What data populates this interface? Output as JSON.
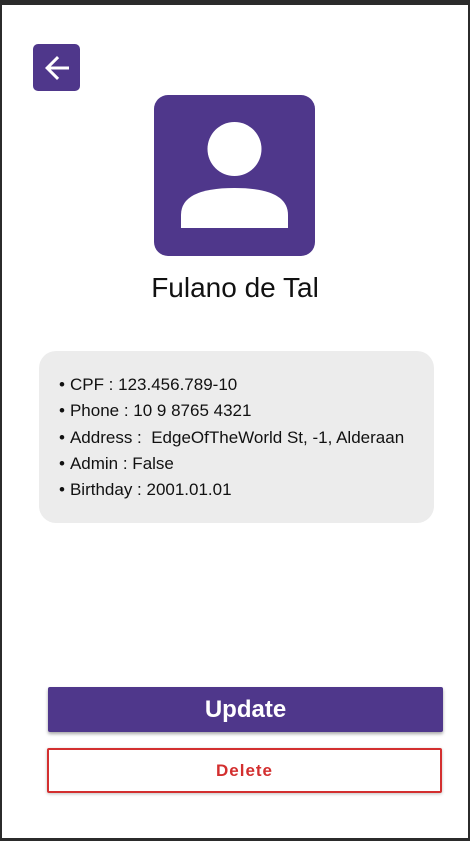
{
  "colors": {
    "primary": "#4f378b",
    "danger": "#d32f2f",
    "card_bg": "#ececec"
  },
  "header": {
    "back_icon": "arrow-left-icon"
  },
  "profile": {
    "avatar_icon": "person-icon",
    "name": "Fulano de Tal"
  },
  "details": [
    {
      "label": "CPF",
      "value": "123.456.789-10",
      "text": "CPF : 123.456.789-10"
    },
    {
      "label": "Phone",
      "value": "10 9 8765 4321",
      "text": "Phone : 10 9 8765 4321"
    },
    {
      "label": "Address",
      "value": "EdgeOfTheWorld St, -1, Alderaan",
      "text": "Address :  EdgeOfTheWorld St, -1, Alderaan"
    },
    {
      "label": "Admin",
      "value": "False",
      "text": "Admin : False"
    },
    {
      "label": "Birthday",
      "value": "2001.01.01",
      "text": "Birthday : 2001.01.01"
    }
  ],
  "actions": {
    "update_label": "Update",
    "delete_label": "Delete"
  }
}
